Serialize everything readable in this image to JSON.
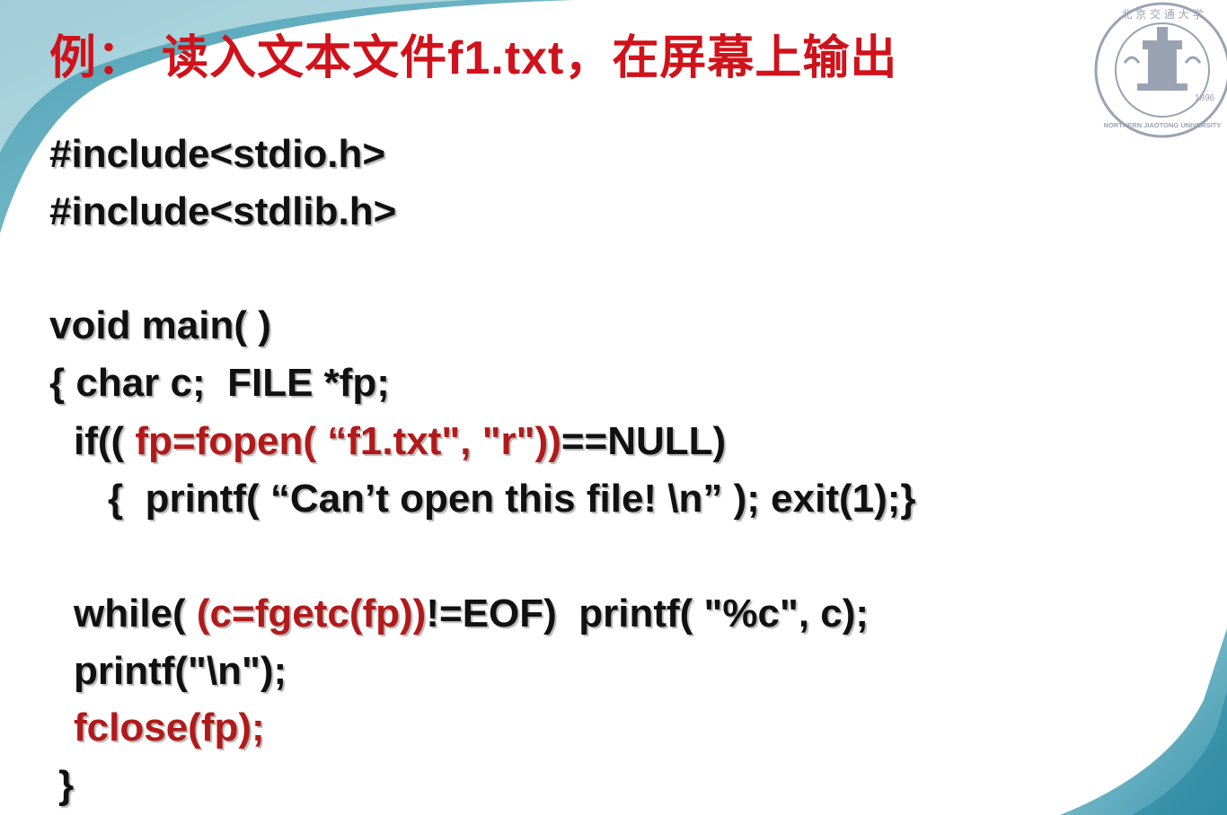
{
  "slide": {
    "title_prefix": "例：",
    "title_main": "读入文本文件",
    "title_file": "f1.txt",
    "title_suffix": "，在屏幕上输出"
  },
  "logo": {
    "icon": "university-seal-icon",
    "text_top": "北 京 交 通 大 学",
    "text_bottom": "NORTHERN JIAOTONG UNIVERSITY",
    "year": "1896"
  },
  "code": {
    "line1": "#include<stdio.h>",
    "line2": "#include<stdlib.h>",
    "line3": "void main( )",
    "line4": "{ char c;  FILE *fp;",
    "line5_a": "if(( ",
    "line5_b": "fp=fopen( “f1.txt\", \"r\"))",
    "line5_c": "==NULL)",
    "line6": "{  printf( “Can’t open this file! \\n” ); exit(1);}",
    "line7_a": "while( ",
    "line7_b": "(c=fgetc(fp))",
    "line7_c": "!=EOF)  printf( \"%c\", c);",
    "line8": "printf(\"\\n\");",
    "line9": "fclose(fp);",
    "line10": "}"
  },
  "colors": {
    "title": "#d0121b",
    "code_text": "#111111",
    "code_highlight": "#b11a1a",
    "decoration_teal": "#3a9bb0",
    "seal": "#9aa3b3"
  }
}
